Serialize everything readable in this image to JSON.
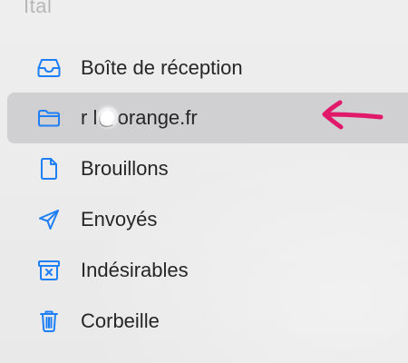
{
  "sidebar": {
    "header_label": "Ital",
    "items": [
      {
        "label": "Boîte de réception",
        "icon": "inbox-tray-icon",
        "selected": false
      },
      {
        "label": "r  l@orange.fr",
        "icon": "folder-icon",
        "selected": true
      },
      {
        "label": "Brouillons",
        "icon": "document-icon",
        "selected": false
      },
      {
        "label": "Envoyés",
        "icon": "paper-plane-icon",
        "selected": false
      },
      {
        "label": "Indésirables",
        "icon": "junk-box-icon",
        "selected": false
      },
      {
        "label": "Corbeille",
        "icon": "trash-icon",
        "selected": false
      }
    ]
  },
  "colors": {
    "icon_blue": "#1f7ff5",
    "arrow_pink": "#e0196a",
    "selected_background": "#d0d0d2"
  },
  "annotation": {
    "icon": "pink-arrow-icon"
  }
}
